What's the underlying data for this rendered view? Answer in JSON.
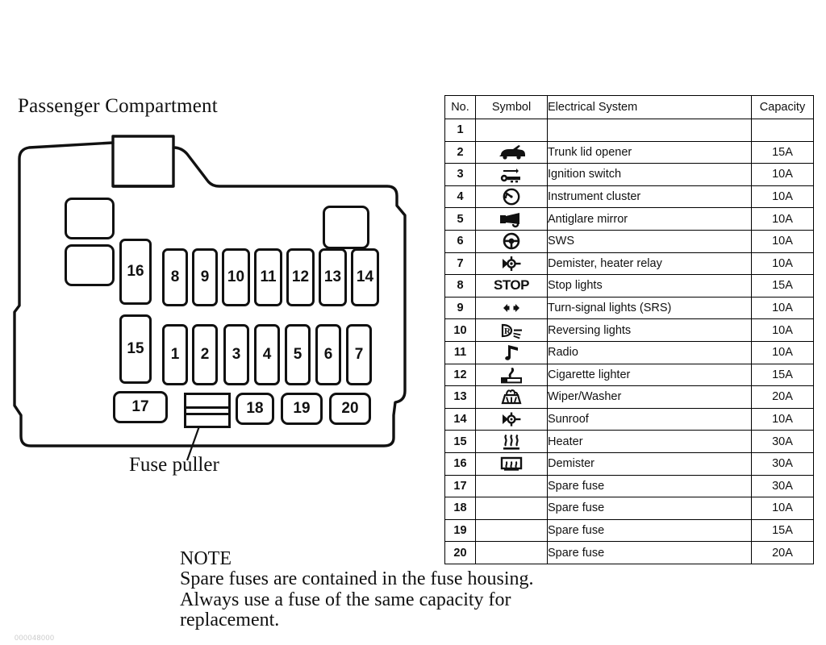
{
  "diagram": {
    "title": "Passenger Compartment",
    "puller_label": "Fuse puller",
    "fuse_slots": [
      {
        "id": "16",
        "label": "16"
      },
      {
        "id": "15",
        "label": "15"
      },
      {
        "id": "17",
        "label": "17"
      },
      {
        "id": "8",
        "label": "8"
      },
      {
        "id": "9",
        "label": "9"
      },
      {
        "id": "10",
        "label": "10"
      },
      {
        "id": "11",
        "label": "11"
      },
      {
        "id": "12",
        "label": "12"
      },
      {
        "id": "13",
        "label": "13"
      },
      {
        "id": "14",
        "label": "14"
      },
      {
        "id": "1",
        "label": "1"
      },
      {
        "id": "2",
        "label": "2"
      },
      {
        "id": "3",
        "label": "3"
      },
      {
        "id": "4",
        "label": "4"
      },
      {
        "id": "5",
        "label": "5"
      },
      {
        "id": "6",
        "label": "6"
      },
      {
        "id": "7",
        "label": "7"
      },
      {
        "id": "18",
        "label": "18"
      },
      {
        "id": "19",
        "label": "19"
      },
      {
        "id": "20",
        "label": "20"
      }
    ]
  },
  "table": {
    "headers": [
      "No.",
      "Symbol",
      "Electrical System",
      "Capacity"
    ],
    "rows": [
      {
        "no": "1",
        "symbol": "",
        "system": "",
        "capacity": ""
      },
      {
        "no": "2",
        "symbol": "car-trunk-icon",
        "system": "Trunk lid opener",
        "capacity": "15A"
      },
      {
        "no": "3",
        "symbol": "ignition-key-icon",
        "system": "Ignition switch",
        "capacity": "10A"
      },
      {
        "no": "4",
        "symbol": "gauge-icon",
        "system": "Instrument cluster",
        "capacity": "10A"
      },
      {
        "no": "5",
        "symbol": "horn-icon",
        "system": "Antiglare mirror",
        "capacity": "10A"
      },
      {
        "no": "6",
        "symbol": "steering-wheel-icon",
        "system": "SWS",
        "capacity": "10A"
      },
      {
        "no": "7",
        "symbol": "relay-icon",
        "system": "Demister, heater relay",
        "capacity": "10A"
      },
      {
        "no": "8",
        "symbol": "stop-text-icon",
        "system": "Stop lights",
        "capacity": "15A"
      },
      {
        "no": "9",
        "symbol": "turn-arrows-icon",
        "system": "Turn-signal lights (SRS)",
        "capacity": "10A"
      },
      {
        "no": "10",
        "symbol": "reversing-light-icon",
        "system": "Reversing lights",
        "capacity": "10A"
      },
      {
        "no": "11",
        "symbol": "music-note-icon",
        "system": "Radio",
        "capacity": "10A"
      },
      {
        "no": "12",
        "symbol": "cigarette-icon",
        "system": "Cigarette lighter",
        "capacity": "15A"
      },
      {
        "no": "13",
        "symbol": "wiper-washer-icon",
        "system": "Wiper/Washer",
        "capacity": "20A"
      },
      {
        "no": "14",
        "symbol": "sunroof-relay-icon",
        "system": "Sunroof",
        "capacity": "10A"
      },
      {
        "no": "15",
        "symbol": "heater-icon",
        "system": "Heater",
        "capacity": "30A"
      },
      {
        "no": "16",
        "symbol": "demister-icon",
        "system": "Demister",
        "capacity": "30A"
      },
      {
        "no": "17",
        "symbol": "",
        "system": "Spare fuse",
        "capacity": "30A"
      },
      {
        "no": "18",
        "symbol": "",
        "system": "Spare fuse",
        "capacity": "10A"
      },
      {
        "no": "19",
        "symbol": "",
        "system": "Spare fuse",
        "capacity": "15A"
      },
      {
        "no": "20",
        "symbol": "",
        "system": "Spare fuse",
        "capacity": "20A"
      }
    ]
  },
  "note": {
    "title": "NOTE",
    "line1": "Spare fuses are contained in the fuse housing.",
    "line2": "Always use a fuse of the same capacity for",
    "line3": "replacement."
  },
  "corner_code": "000048000",
  "colors": {
    "ink": "#111111",
    "paper": "#ffffff"
  }
}
